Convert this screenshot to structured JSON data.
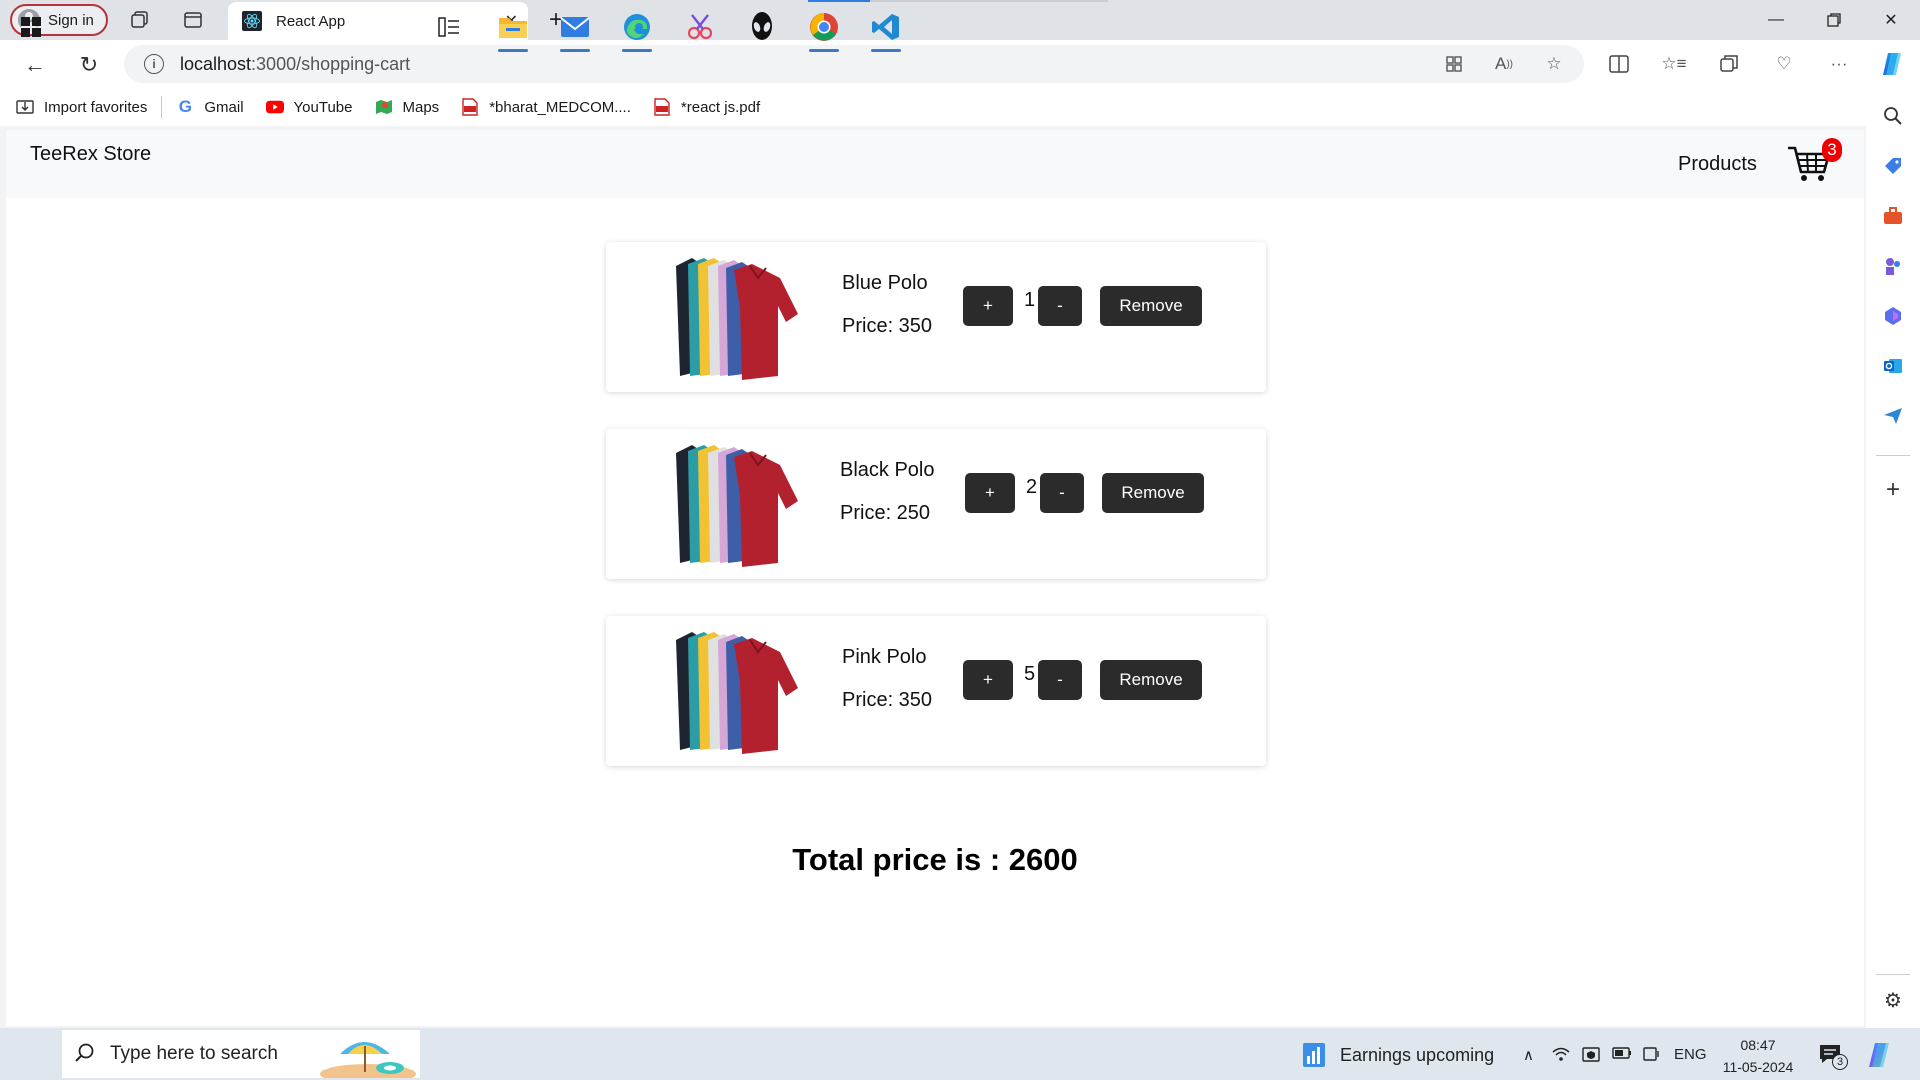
{
  "browser": {
    "signin_label": "Sign in",
    "tab_title": "React App",
    "url_host": "localhost",
    "url_rest": ":3000/shopping-cart",
    "bookmarks": [
      {
        "label": "Import favorites",
        "icon": "import-icon"
      },
      {
        "label": "Gmail",
        "icon": "google-icon"
      },
      {
        "label": "YouTube",
        "icon": "youtube-icon"
      },
      {
        "label": "Maps",
        "icon": "maps-icon"
      },
      {
        "label": "*bharat_MEDCOM....",
        "icon": "pdf-icon"
      },
      {
        "label": "*react js.pdf",
        "icon": "pdf-icon"
      }
    ]
  },
  "app": {
    "brand": "TeeRex Store",
    "nav_products": "Products",
    "cart_count": "3"
  },
  "cart": {
    "items": [
      {
        "name": "Blue Polo",
        "price_label": "Price: 350",
        "qty": "1"
      },
      {
        "name": "Black Polo",
        "price_label": "Price: 250",
        "qty": "2"
      },
      {
        "name": "Pink Polo",
        "price_label": "Price: 350",
        "qty": "5"
      }
    ],
    "plus_label": "+",
    "minus_label": "-",
    "remove_label": "Remove",
    "total_label": "Total price is : 2600"
  },
  "taskbar": {
    "search_placeholder": "Type here to search",
    "weather": "Earnings upcoming",
    "lang": "ENG",
    "time": "08:47",
    "date": "11-05-2024",
    "notifications": "3"
  },
  "colors": {
    "button_bg": "#2b2b2b",
    "badge_bg": "#ee0000",
    "navbar_bg": "#f8f9fa"
  }
}
